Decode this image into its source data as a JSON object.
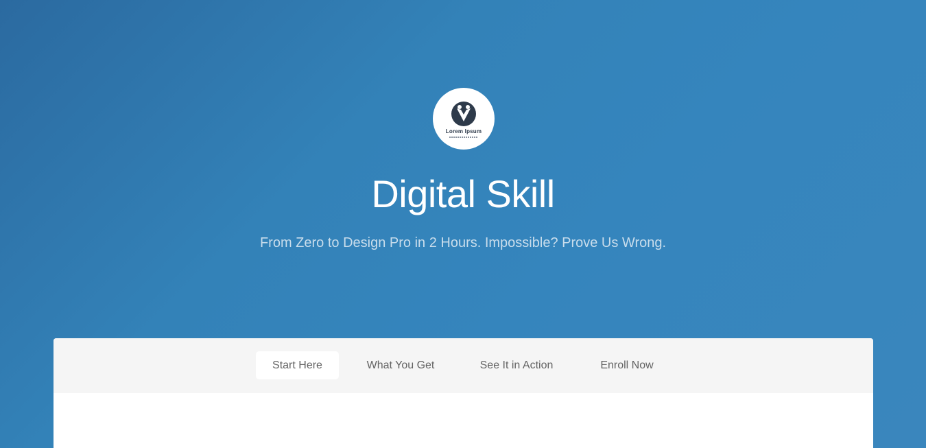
{
  "hero": {
    "logo": {
      "icon": "people-emblem-icon",
      "brand": "Lorem Ipsum"
    },
    "title": "Digital Skill",
    "subtitle": "From Zero to Design Pro in 2 Hours. Impossible? Prove Us Wrong."
  },
  "nav": {
    "items": [
      {
        "label": "Start Here",
        "active": true
      },
      {
        "label": "What You Get",
        "active": false
      },
      {
        "label": "See It in Action",
        "active": false
      },
      {
        "label": "Enroll Now",
        "active": false
      }
    ]
  },
  "colors": {
    "background_blue": "#3382b8",
    "nav_bar": "#f5f5f5",
    "nav_text": "#636363",
    "logo_dark": "#2e3a4a"
  }
}
